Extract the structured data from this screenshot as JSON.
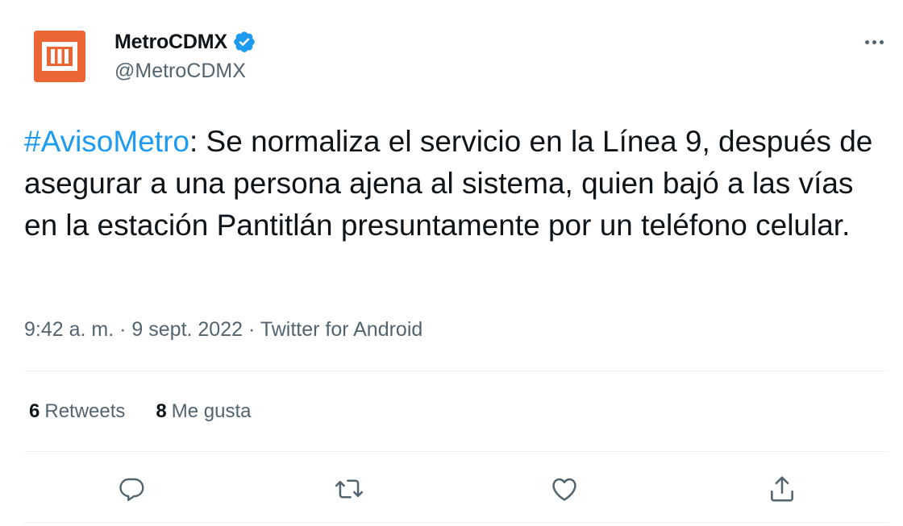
{
  "account": {
    "display_name": "MetroCDMX",
    "handle": "@MetroCDMX",
    "verified": true,
    "avatar_icon": "metro-logo-icon",
    "avatar_color": "#ec6535"
  },
  "tweet": {
    "hashtag": "#AvisoMetro",
    "text": ": Se normaliza el servicio en la Línea 9, después de asegurar a una persona ajena al sistema, quien bajó a las vías en la estación Pantitlán presuntamente por un teléfono celular.",
    "time": "9:42 a. m.",
    "date": "9 sept. 2022",
    "source": "Twitter for Android",
    "separator": "·"
  },
  "stats": {
    "retweets_count": "6",
    "retweets_label": "Retweets",
    "likes_count": "8",
    "likes_label": "Me gusta"
  },
  "actions": [
    {
      "icon": "reply-icon"
    },
    {
      "icon": "retweet-icon"
    },
    {
      "icon": "like-icon"
    },
    {
      "icon": "share-icon"
    }
  ],
  "colors": {
    "link": "#1d9bf0",
    "secondary_text": "#536471",
    "primary_text": "#0f1419",
    "verified_badge": "#1d9bf0"
  }
}
